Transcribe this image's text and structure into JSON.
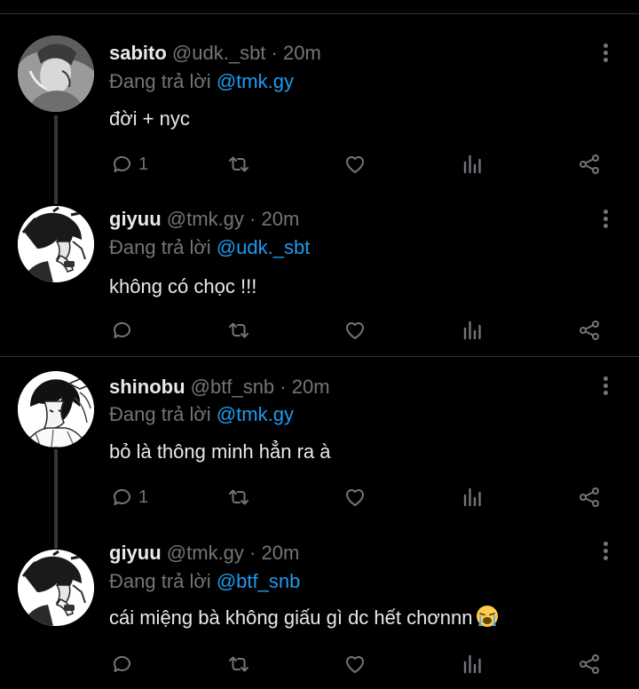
{
  "tweets": [
    {
      "name": "sabito",
      "handle": "@udk._sbt",
      "dot": "·",
      "time": "20m",
      "reply_prefix": "Đang trả lời",
      "reply_to": "@tmk.gy",
      "text": "đời + nyc",
      "reply_count": "1"
    },
    {
      "name": "giyuu",
      "handle": "@tmk.gy",
      "dot": "·",
      "time": "20m",
      "reply_prefix": "Đang trả lời",
      "reply_to": "@udk._sbt",
      "text": "không có chọc !!!",
      "reply_count": ""
    },
    {
      "name": "shinobu",
      "handle": "@btf_snb",
      "dot": "·",
      "time": "20m",
      "reply_prefix": "Đang trả lời",
      "reply_to": "@tmk.gy",
      "text": "bỏ là thông minh hẳn ra à",
      "reply_count": "1"
    },
    {
      "name": "giyuu",
      "handle": "@tmk.gy",
      "dot": "·",
      "time": "20m",
      "reply_prefix": "Đang trả lời",
      "reply_to": "@btf_snb",
      "text": "cái miệng bà không giấu gì dc hết chơnnn",
      "reply_count": ""
    }
  ],
  "emoji": "loudly-crying-face",
  "colors": {
    "background": "#000000",
    "text": "#e7e9ea",
    "muted": "#71767b",
    "link": "#1d9bf0",
    "divider": "#2f3336"
  },
  "icons": [
    "reply-icon",
    "retweet-icon",
    "like-icon",
    "views-icon",
    "share-icon",
    "more-icon"
  ]
}
